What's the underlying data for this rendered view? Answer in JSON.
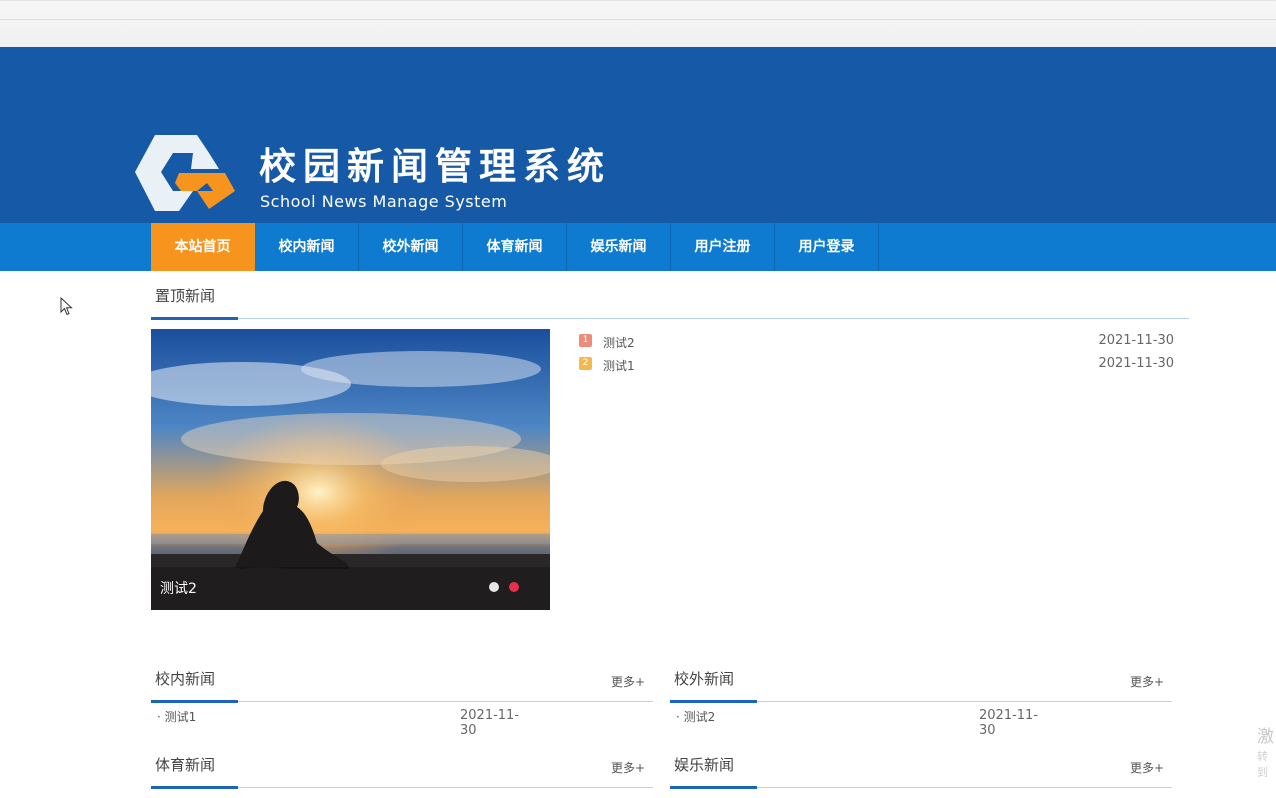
{
  "header": {
    "title": "校园新闻管理系统",
    "subtitle": "School News Manage System",
    "bg_color": "#1659a6",
    "logo_icon": "hexagon-g-logo"
  },
  "nav": {
    "bg_color": "#0e7bd1",
    "active_color": "#f7941d",
    "items": [
      {
        "label": "本站首页",
        "active": true
      },
      {
        "label": "校内新闻",
        "active": false
      },
      {
        "label": "校外新闻",
        "active": false
      },
      {
        "label": "体育新闻",
        "active": false
      },
      {
        "label": "娱乐新闻",
        "active": false
      },
      {
        "label": "用户注册",
        "active": false
      },
      {
        "label": "用户登录",
        "active": false
      }
    ]
  },
  "top_news": {
    "heading": "置顶新闻",
    "slide": {
      "caption": "测试2",
      "dots": [
        {
          "color": "#e6e6e6",
          "active": false
        },
        {
          "color": "#e8304a",
          "active": true
        }
      ]
    },
    "items": [
      {
        "rank": "1",
        "title": "测试2",
        "date": "2021-11-30",
        "badge_color": "#ec8d7a"
      },
      {
        "rank": "2",
        "title": "测试1",
        "date": "2021-11-30",
        "badge_color": "#f3b94f"
      }
    ]
  },
  "sections": {
    "campus": {
      "heading": "校内新闻",
      "more": "更多+",
      "items": [
        {
          "title": "· 测试1",
          "date": "2021-11-30"
        }
      ]
    },
    "external": {
      "heading": "校外新闻",
      "more": "更多+",
      "items": [
        {
          "title": "· 测试2",
          "date": "2021-11-30"
        }
      ]
    },
    "sports": {
      "heading": "体育新闻",
      "more": "更多+"
    },
    "entertainment": {
      "heading": "娱乐新闻",
      "more": "更多+"
    }
  },
  "watermark": {
    "char": "激",
    "sub": "转到"
  },
  "cursor_icon": "mouse-pointer-icon"
}
